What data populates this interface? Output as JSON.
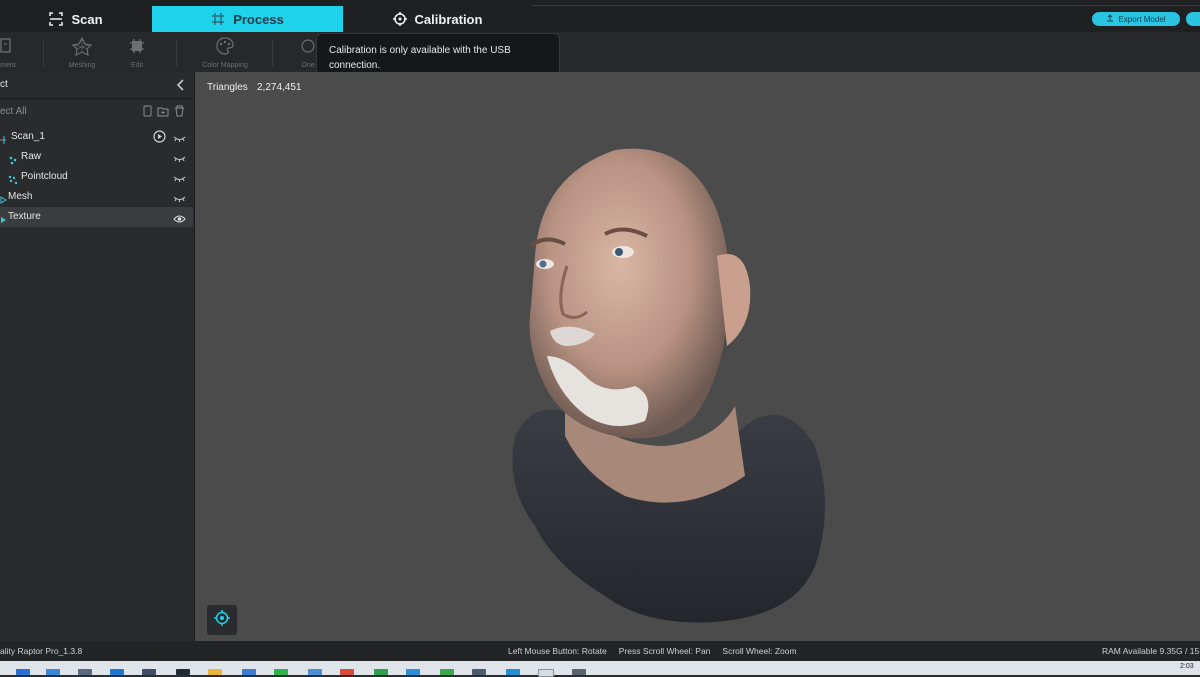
{
  "tabs": [
    {
      "label": "Scan",
      "icon": "scan-frame-icon"
    },
    {
      "label": "Process",
      "icon": "process-frame-icon"
    },
    {
      "label": "Calibration",
      "icon": "crosshair-icon"
    }
  ],
  "header": {
    "export_label": "Export Model"
  },
  "toolbar": {
    "items": [
      {
        "label": "Alignment",
        "visible_text": "nment",
        "icon": "align-icon"
      },
      {
        "label": "Meshing",
        "icon": "meshing-icon"
      },
      {
        "label": "Edit",
        "icon": "edit-icon"
      },
      {
        "label": "Color Mapping",
        "icon": "color-mapping-icon"
      },
      {
        "label": "One",
        "icon": "one-click-icon"
      }
    ]
  },
  "tooltip": {
    "text": "Calibration is only available with the USB connection."
  },
  "left_panel": {
    "title": "ct",
    "select_all": "ect All",
    "tree": [
      {
        "label": "Scan_1",
        "icon": "scan-node-icon",
        "visibility": "hidden"
      },
      {
        "label": "Raw",
        "icon": "raw-node-icon",
        "visibility": "hidden"
      },
      {
        "label": "Pointcloud",
        "icon": "pointcloud-node-icon",
        "visibility": "hidden"
      },
      {
        "label": "Mesh",
        "icon": "mesh-node-icon",
        "visibility": "hidden"
      },
      {
        "label": "Texture",
        "icon": "texture-node-icon",
        "visibility": "visible",
        "selected": true
      }
    ]
  },
  "viewport": {
    "triangles_label": "Triangles",
    "triangles_value": "2,274,451"
  },
  "status": {
    "version": "ality Raptor Pro_1.3.8",
    "hints": [
      "Left Mouse Button: Rotate",
      "Press Scroll Wheel: Pan",
      "Scroll Wheel: Zoom"
    ],
    "ram": "RAM Available 9.35G / 15"
  },
  "taskbar": {
    "clock": "2:03"
  },
  "colors": {
    "accent": "#1fd2ec",
    "panel": "#2a2b2d",
    "viewport": "#4b4b4c"
  }
}
